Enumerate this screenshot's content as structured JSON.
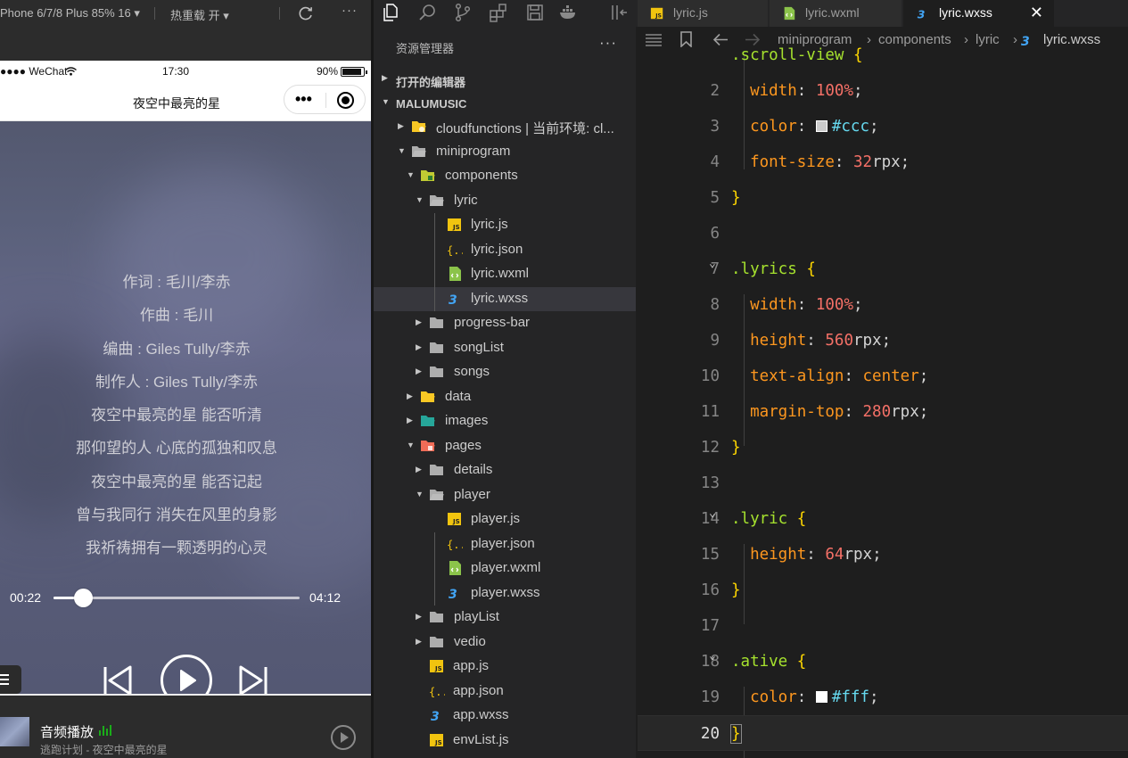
{
  "simulator": {
    "device_label": "Phone 6/7/8 Plus 85% 16 ▾",
    "hot_reload_label": "热重载 开 ▾",
    "more": "···",
    "status": {
      "carrier": "●●●● WeChat",
      "time": "17:30",
      "battery": "90%"
    },
    "nav_title": "夜空中最亮的星",
    "lyrics": [
      "作词 : 毛川/李赤",
      "作曲 : 毛川",
      "编曲 : Giles Tully/李赤",
      "制作人 : Giles Tully/李赤",
      "夜空中最亮的星 能否听清",
      "那仰望的人 心底的孤独和叹息",
      "夜空中最亮的星 能否记起",
      "曾与我同行 消失在风里的身影",
      "我祈祷拥有一颗透明的心灵"
    ],
    "progress": {
      "current": "00:22",
      "total": "04:12",
      "fraction": 0.12
    },
    "mini_player": {
      "title": "音频播放",
      "subtitle": "逃跑计划 - 夜空中最亮的星"
    }
  },
  "tabs": [
    {
      "label": "lyric.js",
      "icon": "js-file-icon",
      "active": false
    },
    {
      "label": "lyric.wxml",
      "icon": "wxml-file-icon",
      "active": false
    },
    {
      "label": "lyric.wxss",
      "icon": "css-file-icon",
      "active": true,
      "close": "✕"
    }
  ],
  "explorer": {
    "title": "资源管理器",
    "more": "···",
    "open_editors": "打开的编辑器",
    "project": "MALUMUSIC",
    "tree": [
      {
        "label": "cloudfunctions | 当前环境: cl...",
        "depth": 0,
        "kind": "folder-cloud",
        "twisty": "▶"
      },
      {
        "label": "miniprogram",
        "depth": 0,
        "kind": "folder-open",
        "twisty": "▼"
      },
      {
        "label": "components",
        "depth": 1,
        "kind": "folder-components",
        "twisty": "▼"
      },
      {
        "label": "lyric",
        "depth": 2,
        "kind": "folder-open",
        "twisty": "▼"
      },
      {
        "label": "lyric.js",
        "depth": 3,
        "kind": "js"
      },
      {
        "label": "lyric.json",
        "depth": 3,
        "kind": "json"
      },
      {
        "label": "lyric.wxml",
        "depth": 3,
        "kind": "wxml"
      },
      {
        "label": "lyric.wxss",
        "depth": 3,
        "kind": "css",
        "selected": true
      },
      {
        "label": "progress-bar",
        "depth": 2,
        "kind": "folder",
        "twisty": "▶"
      },
      {
        "label": "songList",
        "depth": 2,
        "kind": "folder",
        "twisty": "▶"
      },
      {
        "label": "songs",
        "depth": 2,
        "kind": "folder",
        "twisty": "▶"
      },
      {
        "label": "data",
        "depth": 1,
        "kind": "folder-data",
        "twisty": "▶"
      },
      {
        "label": "images",
        "depth": 1,
        "kind": "folder-images",
        "twisty": "▶"
      },
      {
        "label": "pages",
        "depth": 1,
        "kind": "folder-pages",
        "twisty": "▼"
      },
      {
        "label": "details",
        "depth": 2,
        "kind": "folder",
        "twisty": "▶"
      },
      {
        "label": "player",
        "depth": 2,
        "kind": "folder-open",
        "twisty": "▼"
      },
      {
        "label": "player.js",
        "depth": 3,
        "kind": "js"
      },
      {
        "label": "player.json",
        "depth": 3,
        "kind": "json"
      },
      {
        "label": "player.wxml",
        "depth": 3,
        "kind": "wxml"
      },
      {
        "label": "player.wxss",
        "depth": 3,
        "kind": "css"
      },
      {
        "label": "playList",
        "depth": 2,
        "kind": "folder",
        "twisty": "▶"
      },
      {
        "label": "vedio",
        "depth": 2,
        "kind": "folder",
        "twisty": "▶"
      },
      {
        "label": "app.js",
        "depth": 1,
        "kind": "js"
      },
      {
        "label": "app.json",
        "depth": 1,
        "kind": "json"
      },
      {
        "label": "app.wxss",
        "depth": 1,
        "kind": "css"
      },
      {
        "label": "envList.js",
        "depth": 1,
        "kind": "js"
      }
    ]
  },
  "breadcrumb": [
    "miniprogram",
    "components",
    "lyric",
    "lyric.wxss"
  ],
  "editor": {
    "current_line": 20,
    "lines": [
      {
        "n": "",
        "tokens": [
          [
            "sel",
            ".scroll-view"
          ],
          [
            "punc",
            " "
          ],
          [
            "brace",
            "{"
          ]
        ]
      },
      {
        "n": "2",
        "tokens": [
          [
            "punc",
            "  "
          ],
          [
            "prop",
            "width"
          ],
          [
            "punc",
            ": "
          ],
          [
            "num",
            "100%"
          ],
          [
            "punc",
            ";"
          ]
        ]
      },
      {
        "n": "3",
        "tokens": [
          [
            "punc",
            "  "
          ],
          [
            "prop",
            "color"
          ],
          [
            "punc",
            ": "
          ],
          [
            "swatch",
            "#cccccc"
          ],
          [
            "hash",
            "#ccc"
          ],
          [
            "punc",
            ";"
          ]
        ]
      },
      {
        "n": "4",
        "tokens": [
          [
            "punc",
            "  "
          ],
          [
            "prop",
            "font-size"
          ],
          [
            "punc",
            ": "
          ],
          [
            "num",
            "32"
          ],
          [
            "unit",
            "rpx"
          ],
          [
            "punc",
            ";"
          ]
        ]
      },
      {
        "n": "5",
        "tokens": [
          [
            "brace",
            "}"
          ]
        ]
      },
      {
        "n": "6",
        "tokens": []
      },
      {
        "n": "7",
        "fold": true,
        "tokens": [
          [
            "sel",
            ".lyrics"
          ],
          [
            "punc",
            " "
          ],
          [
            "brace",
            "{"
          ]
        ]
      },
      {
        "n": "8",
        "tokens": [
          [
            "punc",
            "  "
          ],
          [
            "prop",
            "width"
          ],
          [
            "punc",
            ": "
          ],
          [
            "num",
            "100%"
          ],
          [
            "punc",
            ";"
          ]
        ]
      },
      {
        "n": "9",
        "tokens": [
          [
            "punc",
            "  "
          ],
          [
            "prop",
            "height"
          ],
          [
            "punc",
            ": "
          ],
          [
            "num",
            "560"
          ],
          [
            "unit",
            "rpx"
          ],
          [
            "punc",
            ";"
          ]
        ]
      },
      {
        "n": "10",
        "tokens": [
          [
            "punc",
            "  "
          ],
          [
            "prop",
            "text-align"
          ],
          [
            "punc",
            ": "
          ],
          [
            "kw",
            "center"
          ],
          [
            "punc",
            ";"
          ]
        ]
      },
      {
        "n": "11",
        "tokens": [
          [
            "punc",
            "  "
          ],
          [
            "prop",
            "margin-top"
          ],
          [
            "punc",
            ": "
          ],
          [
            "num",
            "280"
          ],
          [
            "unit",
            "rpx"
          ],
          [
            "punc",
            ";"
          ]
        ]
      },
      {
        "n": "12",
        "tokens": [
          [
            "brace",
            "}"
          ]
        ]
      },
      {
        "n": "13",
        "tokens": []
      },
      {
        "n": "14",
        "fold": true,
        "tokens": [
          [
            "sel",
            ".lyric"
          ],
          [
            "punc",
            " "
          ],
          [
            "brace",
            "{"
          ]
        ]
      },
      {
        "n": "15",
        "tokens": [
          [
            "punc",
            "  "
          ],
          [
            "prop",
            "height"
          ],
          [
            "punc",
            ": "
          ],
          [
            "num",
            "64"
          ],
          [
            "unit",
            "rpx"
          ],
          [
            "punc",
            ";"
          ]
        ]
      },
      {
        "n": "16",
        "tokens": [
          [
            "brace",
            "}"
          ]
        ]
      },
      {
        "n": "17",
        "tokens": []
      },
      {
        "n": "18",
        "fold": true,
        "tokens": [
          [
            "sel",
            ".ative"
          ],
          [
            "punc",
            " "
          ],
          [
            "brace",
            "{"
          ]
        ]
      },
      {
        "n": "19",
        "tokens": [
          [
            "punc",
            "  "
          ],
          [
            "prop",
            "color"
          ],
          [
            "punc",
            ": "
          ],
          [
            "swatch",
            "#ffffff"
          ],
          [
            "hash",
            "#fff"
          ],
          [
            "punc",
            ";"
          ]
        ]
      },
      {
        "n": "20",
        "tokens": [
          [
            "brace",
            "}"
          ]
        ]
      }
    ]
  },
  "colors": {
    "accent": "#007acc",
    "selection": "#37373d",
    "green": "#1aad19"
  }
}
